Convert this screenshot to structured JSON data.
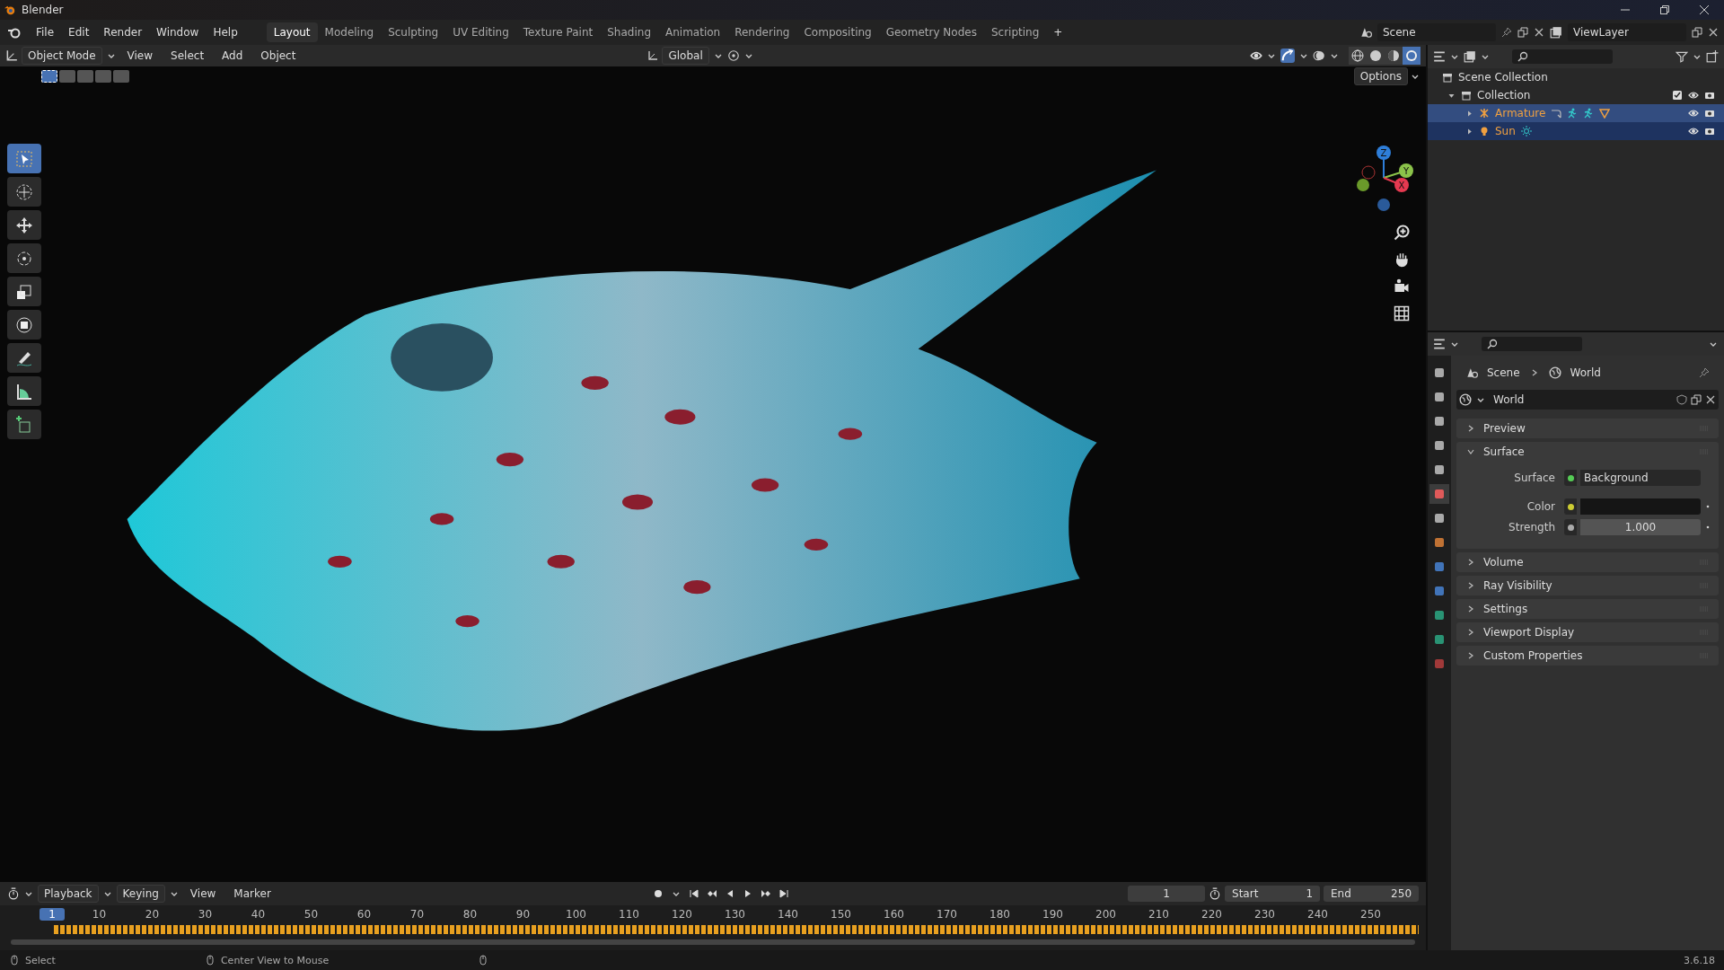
{
  "window": {
    "title": "Blender"
  },
  "menu": [
    "File",
    "Edit",
    "Render",
    "Window",
    "Help"
  ],
  "workspaces": [
    {
      "label": "Layout",
      "selected": true
    },
    {
      "label": "Modeling",
      "selected": false
    },
    {
      "label": "Sculpting",
      "selected": false
    },
    {
      "label": "UV Editing",
      "selected": false
    },
    {
      "label": "Texture Paint",
      "selected": false
    },
    {
      "label": "Shading",
      "selected": false
    },
    {
      "label": "Animation",
      "selected": false
    },
    {
      "label": "Rendering",
      "selected": false
    },
    {
      "label": "Compositing",
      "selected": false
    },
    {
      "label": "Geometry Nodes",
      "selected": false
    },
    {
      "label": "Scripting",
      "selected": false
    }
  ],
  "add_workspace": "+",
  "scene": "Scene",
  "view_layer": "ViewLayer",
  "viewport_header": {
    "mode": "Object Mode",
    "menus": [
      "View",
      "Select",
      "Add",
      "Object"
    ],
    "orientation": "Global",
    "options": "Options",
    "shading": [
      {
        "kind": "wireframe",
        "selected": false
      },
      {
        "kind": "solid",
        "selected": false
      },
      {
        "kind": "material",
        "selected": false
      },
      {
        "kind": "rendered",
        "selected": true
      }
    ],
    "select_modes": [
      {
        "selected": true
      },
      {
        "selected": false
      },
      {
        "selected": false
      },
      {
        "selected": false
      },
      {
        "selected": false
      }
    ]
  },
  "tools": [
    {
      "kind": "select",
      "selected": true
    },
    {
      "kind": "cursor",
      "selected": false
    },
    {
      "kind": "move",
      "selected": false
    },
    {
      "kind": "rotate",
      "selected": false
    },
    {
      "kind": "scale",
      "selected": false
    },
    {
      "kind": "transform",
      "selected": false
    },
    {
      "kind": "annotate",
      "selected": false
    },
    {
      "kind": "measure",
      "selected": false
    },
    {
      "kind": "add-cube",
      "selected": false
    }
  ],
  "gizmo_axes": [
    "Z",
    "Y",
    "X"
  ],
  "outliner": {
    "tree": [
      {
        "label": "Scene Collection",
        "kind": "scene",
        "children": [
          {
            "label": "Collection",
            "kind": "collection",
            "expanded": true,
            "children": [
              {
                "label": "Armature",
                "kind": "armature",
                "selected": true,
                "expanded": false
              },
              {
                "label": "Sun",
                "kind": "light",
                "selected": true,
                "expanded": false
              }
            ]
          }
        ]
      }
    ]
  },
  "properties": {
    "tabs": [
      {
        "kind": "tool",
        "selected": false
      },
      {
        "kind": "render",
        "selected": false
      },
      {
        "kind": "output",
        "selected": false
      },
      {
        "kind": "view-layer",
        "selected": false
      },
      {
        "kind": "scene",
        "selected": false
      },
      {
        "kind": "world",
        "selected": true
      },
      {
        "kind": "collection",
        "selected": false
      },
      {
        "kind": "object",
        "selected": false
      },
      {
        "kind": "physics",
        "selected": false
      },
      {
        "kind": "constraints",
        "selected": false
      },
      {
        "kind": "data",
        "selected": false
      },
      {
        "kind": "bone",
        "selected": false
      },
      {
        "kind": "texture",
        "selected": false
      }
    ],
    "breadcrumb": [
      "Scene",
      "World"
    ],
    "datablock": "World",
    "panels": [
      {
        "label": "Preview",
        "expanded": false
      },
      {
        "label": "Surface",
        "expanded": true,
        "fields": [
          {
            "label": "Surface",
            "kind": "shader",
            "value": "Background"
          },
          {
            "label": "Color",
            "kind": "color"
          },
          {
            "label": "Strength",
            "kind": "value",
            "value": "1.000"
          }
        ]
      },
      {
        "label": "Volume",
        "expanded": false
      },
      {
        "label": "Ray Visibility",
        "expanded": false
      },
      {
        "label": "Settings",
        "expanded": false
      },
      {
        "label": "Viewport Display",
        "expanded": false
      },
      {
        "label": "Custom Properties",
        "expanded": false
      }
    ]
  },
  "timeline": {
    "menus": [
      "Playback",
      "Keying",
      "View",
      "Marker"
    ],
    "current_frame": "1",
    "start_label": "Start",
    "start": "1",
    "end_label": "End",
    "end": "250",
    "playhead": "1",
    "ticks": [
      "10",
      "20",
      "30",
      "40",
      "50",
      "60",
      "70",
      "80",
      "90",
      "100",
      "110",
      "120",
      "130",
      "140",
      "150",
      "160",
      "170",
      "180",
      "190",
      "200",
      "210",
      "220",
      "230",
      "240",
      "250"
    ]
  },
  "status_bar": {
    "items": [
      "Select",
      "Center View to Mouse"
    ],
    "version": "3.6.18"
  }
}
